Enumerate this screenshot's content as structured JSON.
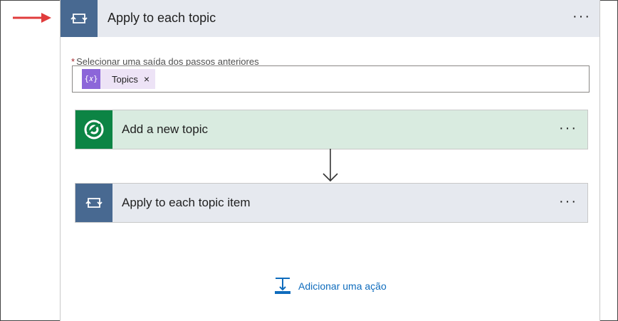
{
  "loop": {
    "title": "Apply to each topic",
    "more_label": "···"
  },
  "field": {
    "required_mark": "*",
    "label": "Selecionar uma saída dos passos anteriores",
    "token": {
      "label": "Topics",
      "remove_label": "×",
      "icon_glyph": "{𝑥}"
    }
  },
  "actions": [
    {
      "title": "Add a new topic",
      "more_label": "···",
      "icon": "dataverse-icon"
    },
    {
      "title": "Apply to each topic item",
      "more_label": "···",
      "icon": "loop-icon"
    }
  ],
  "add_action": {
    "label": "Adicionar uma ação"
  },
  "colors": {
    "loop_icon_bg": "#486991",
    "dataverse_icon_bg": "#0c8444",
    "token_icon_bg": "#8c66d9",
    "link": "#0f6cbd",
    "arrow": "#e03c3c"
  }
}
